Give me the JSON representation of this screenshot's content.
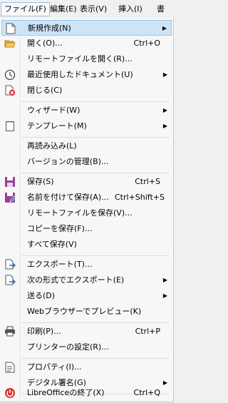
{
  "menubar": [
    {
      "label": "ファイル(F)"
    },
    {
      "label": "編集(E)"
    },
    {
      "label": "表示(V)"
    },
    {
      "label": "挿入(I)"
    },
    {
      "label": "書"
    }
  ],
  "menu": {
    "items": [
      {
        "label": "新規作成(N)",
        "shortcut": "",
        "submenu": true,
        "icon": "new-document-icon",
        "highlighted": true
      },
      {
        "label": "開く(O)...",
        "shortcut": "Ctrl+O",
        "submenu": false,
        "icon": "open-folder-icon"
      },
      {
        "label": "リモートファイルを開く(R)...",
        "shortcut": "",
        "submenu": false,
        "icon": ""
      },
      {
        "label": "最近使用したドキュメント(U)",
        "shortcut": "",
        "submenu": true,
        "icon": "clock-icon"
      },
      {
        "label": "閉じる(C)",
        "shortcut": "",
        "submenu": false,
        "icon": "close-document-icon"
      },
      {
        "label": "ウィザード(W)",
        "shortcut": "",
        "submenu": true,
        "icon": ""
      },
      {
        "label": "テンプレート(M)",
        "shortcut": "",
        "submenu": true,
        "icon": "template-icon"
      },
      {
        "label": "再読み込み(L)",
        "shortcut": "",
        "submenu": false,
        "icon": ""
      },
      {
        "label": "バージョンの管理(B)...",
        "shortcut": "",
        "submenu": false,
        "icon": ""
      },
      {
        "label": "保存(S)",
        "shortcut": "Ctrl+S",
        "submenu": false,
        "icon": "save-icon"
      },
      {
        "label": "名前を付けて保存(A)...",
        "shortcut": "Ctrl+Shift+S",
        "submenu": false,
        "icon": "save-as-icon"
      },
      {
        "label": "リモートファイルを保存(V)...",
        "shortcut": "",
        "submenu": false,
        "icon": ""
      },
      {
        "label": "コピーを保存(F)...",
        "shortcut": "",
        "submenu": false,
        "icon": ""
      },
      {
        "label": "すべて保存(V)",
        "shortcut": "",
        "submenu": false,
        "icon": ""
      },
      {
        "label": "エクスポート(T)...",
        "shortcut": "",
        "submenu": false,
        "icon": "export-icon"
      },
      {
        "label": "次の形式でエクスポート(E)",
        "shortcut": "",
        "submenu": true,
        "icon": "export-as-icon"
      },
      {
        "label": "送る(D)",
        "shortcut": "",
        "submenu": true,
        "icon": ""
      },
      {
        "label": "Webブラウザーでプレビュー(K)",
        "shortcut": "",
        "submenu": false,
        "icon": ""
      },
      {
        "label": "印刷(P)...",
        "shortcut": "Ctrl+P",
        "submenu": false,
        "icon": "printer-icon"
      },
      {
        "label": "プリンターの設定(R)...",
        "shortcut": "",
        "submenu": false,
        "icon": ""
      },
      {
        "label": "プロパティ(I)...",
        "shortcut": "",
        "submenu": false,
        "icon": "properties-icon"
      },
      {
        "label": "デジタル署名(G)",
        "shortcut": "",
        "submenu": true,
        "icon": ""
      },
      {
        "label": "LibreOfficeの終了(X)",
        "shortcut": "Ctrl+Q",
        "submenu": false,
        "icon": "power-icon"
      }
    ]
  },
  "colors": {
    "highlight": "#cde4f7",
    "menu_bg": "#f7f7f7",
    "accent_purple": "#9b3d9b"
  }
}
